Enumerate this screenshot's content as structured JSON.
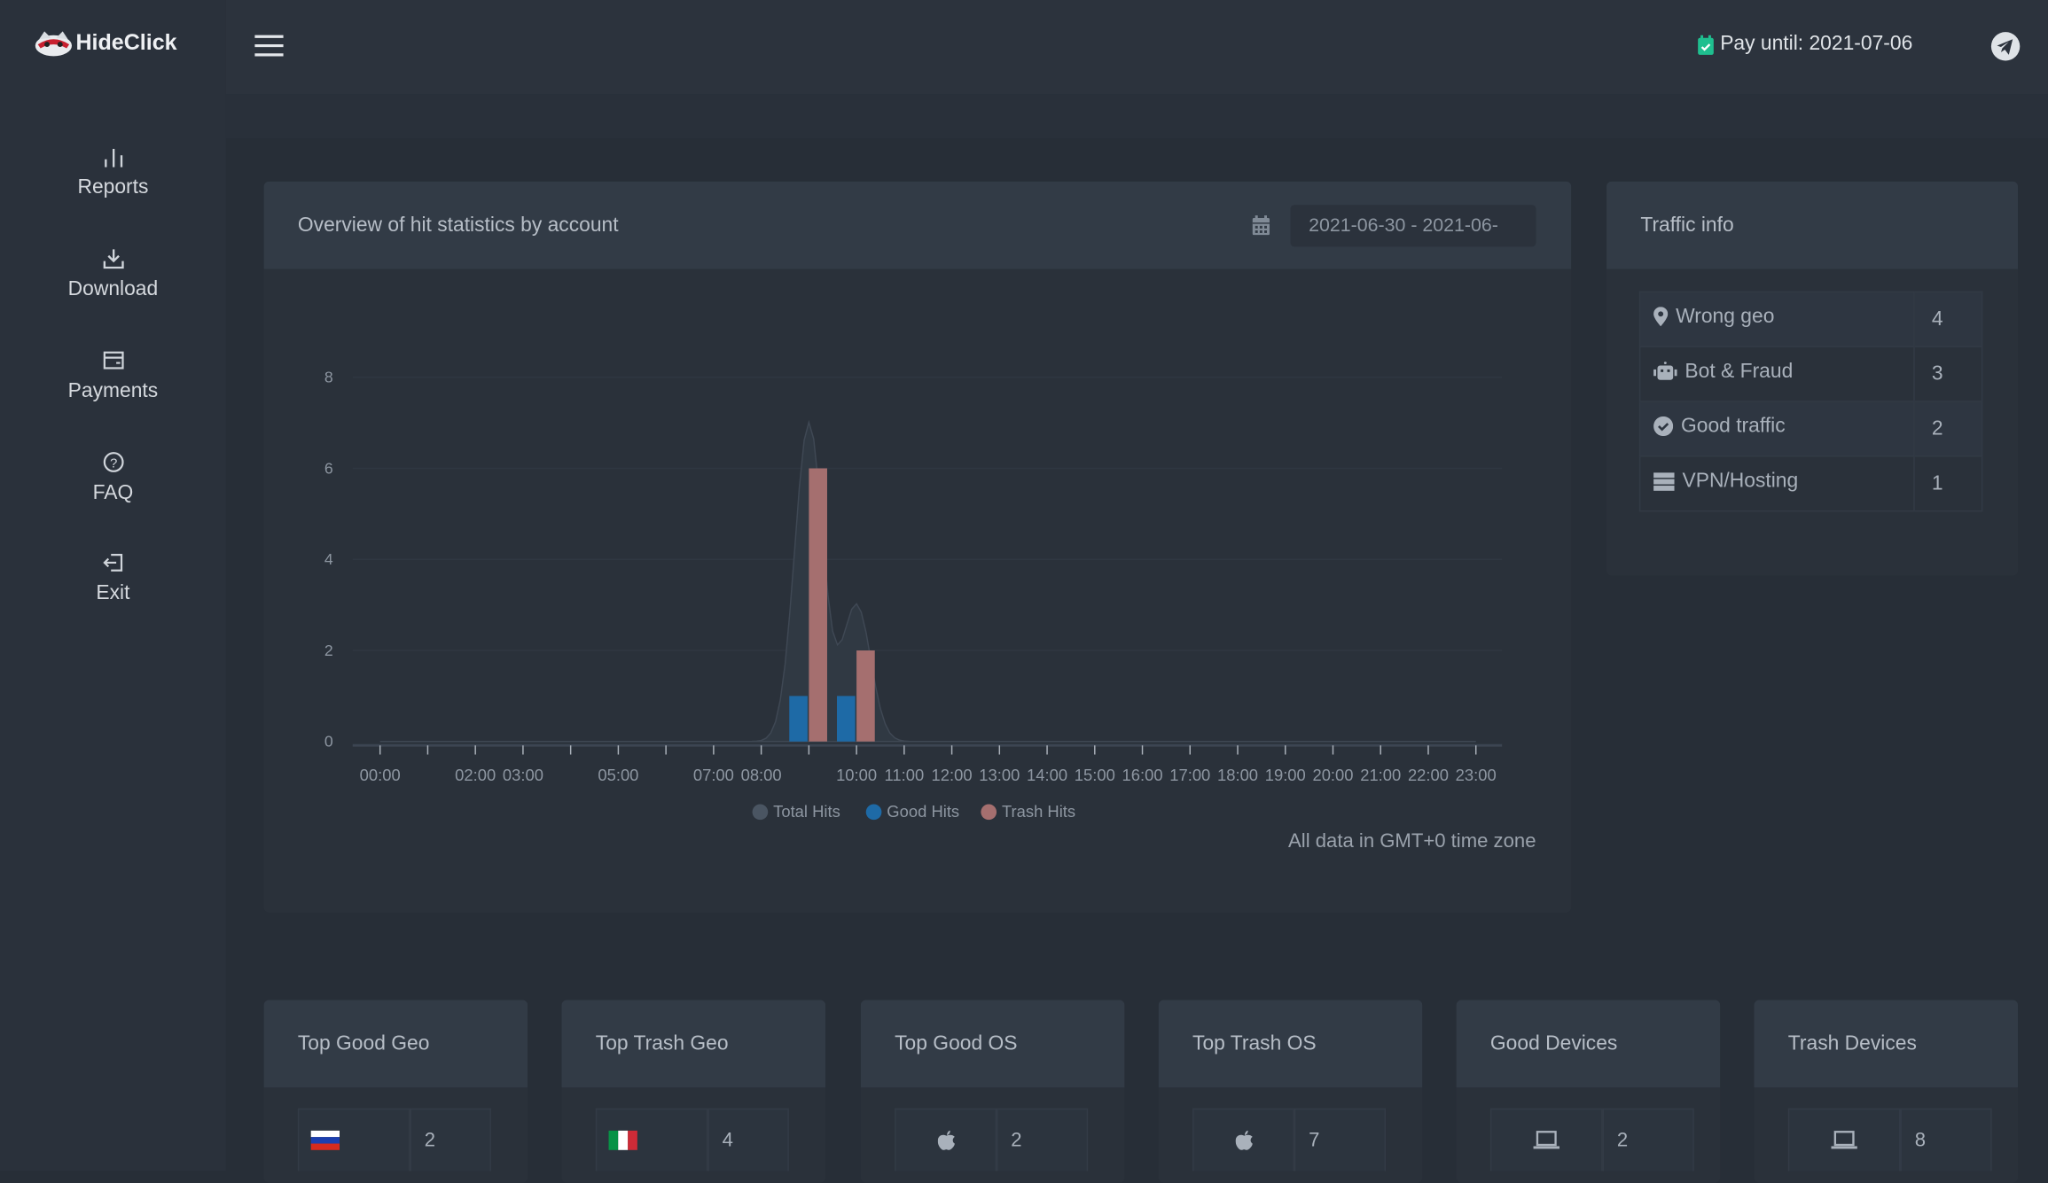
{
  "app": {
    "brand": "HideClick",
    "pay_until": "Pay until: 2021-07-06",
    "brand_color": "#c8202f",
    "accent_green": "#1fbf8f"
  },
  "sidebar": {
    "items": [
      {
        "label": "Reports",
        "icon": "bar-chart-icon"
      },
      {
        "label": "Download",
        "icon": "download-icon"
      },
      {
        "label": "Payments",
        "icon": "credit-card-icon"
      },
      {
        "label": "FAQ",
        "icon": "question-circle-icon"
      },
      {
        "label": "Exit",
        "icon": "exit-icon"
      }
    ]
  },
  "overview": {
    "title": "Overview of hit statistics by account",
    "date_range": "2021-06-30 - 2021-06-",
    "timezone_note": "All data in GMT+0 time zone"
  },
  "chart_data": {
    "type": "bar",
    "x": [
      0,
      1,
      2,
      3,
      4,
      5,
      6,
      7,
      8,
      9,
      10,
      11,
      12,
      13,
      14,
      15,
      16,
      17,
      18,
      19,
      20,
      21,
      22,
      23
    ],
    "x_tick_labels": [
      "00:00",
      "02:00",
      "03:00",
      "05:00",
      "07:00",
      "08:00",
      "10:00",
      "11:00",
      "12:00",
      "13:00",
      "14:00",
      "15:00",
      "16:00",
      "17:00",
      "18:00",
      "19:00",
      "20:00",
      "21:00",
      "22:00",
      "23:00"
    ],
    "x_tick_hours": [
      0,
      2,
      3,
      5,
      7,
      8,
      10,
      11,
      12,
      13,
      14,
      15,
      16,
      17,
      18,
      19,
      20,
      21,
      22,
      23
    ],
    "y_ticks": [
      0,
      2,
      4,
      6,
      8
    ],
    "ylim": [
      0,
      8
    ],
    "grid": true,
    "legend_position": "bottom",
    "series": [
      {
        "name": "Total Hits",
        "kind": "area-spline",
        "color": "#4a5562",
        "values": [
          0,
          0,
          0,
          0,
          0,
          0,
          0,
          0,
          0,
          7,
          3,
          0,
          0,
          0,
          0,
          0,
          0,
          0,
          0,
          0,
          0,
          0,
          0,
          0
        ]
      },
      {
        "name": "Good Hits",
        "kind": "bar",
        "color": "#1e6aa6",
        "values": [
          0,
          0,
          0,
          0,
          0,
          0,
          0,
          0,
          0,
          1,
          1,
          0,
          0,
          0,
          0,
          0,
          0,
          0,
          0,
          0,
          0,
          0,
          0,
          0
        ]
      },
      {
        "name": "Trash Hits",
        "kind": "bar",
        "color": "#a56f6f",
        "values": [
          0,
          0,
          0,
          0,
          0,
          0,
          0,
          0,
          0,
          6,
          2,
          0,
          0,
          0,
          0,
          0,
          0,
          0,
          0,
          0,
          0,
          0,
          0,
          0
        ]
      }
    ]
  },
  "traffic": {
    "title": "Traffic info",
    "rows": [
      {
        "label": "Wrong geo",
        "value": "4",
        "icon": "map-marker-icon"
      },
      {
        "label": "Bot & Fraud",
        "value": "3",
        "icon": "robot-icon"
      },
      {
        "label": "Good traffic",
        "value": "2",
        "icon": "check-circle-icon"
      },
      {
        "label": "VPN/Hosting",
        "value": "1",
        "icon": "server-icon"
      }
    ]
  },
  "tops": [
    {
      "title": "Top Good Geo",
      "icon": "flag-russia-icon",
      "value": "2"
    },
    {
      "title": "Top Trash Geo",
      "icon": "flag-italy-icon",
      "value": "4"
    },
    {
      "title": "Top Good OS",
      "icon": "apple-icon",
      "value": "2"
    },
    {
      "title": "Top Trash OS",
      "icon": "apple-icon",
      "value": "7"
    },
    {
      "title": "Good Devices",
      "icon": "laptop-icon",
      "value": "2"
    },
    {
      "title": "Trash Devices",
      "icon": "laptop-icon",
      "value": "8"
    }
  ]
}
